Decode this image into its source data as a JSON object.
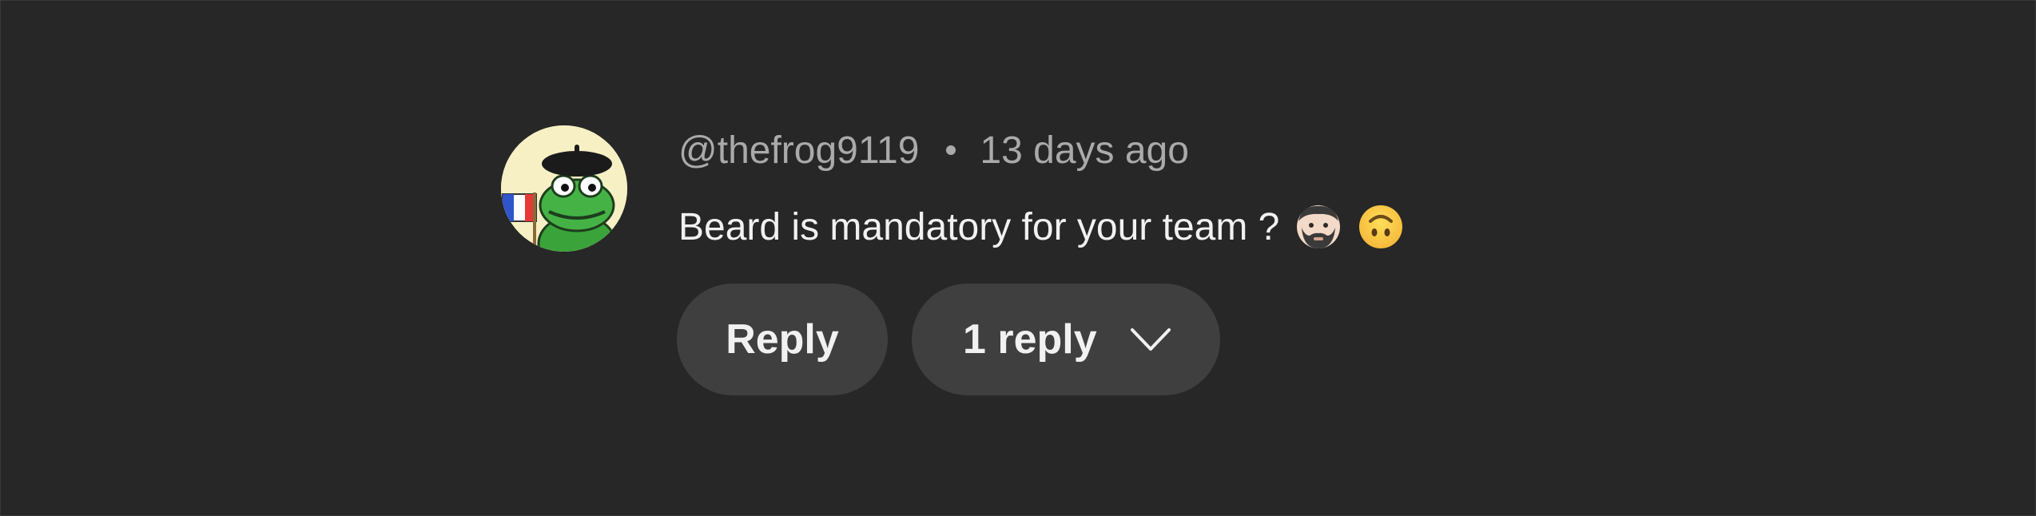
{
  "comment": {
    "author": "@thefrog9119",
    "time": "13 days ago",
    "text": "Beard is mandatory for your team ?",
    "emojis": [
      "man-beard-emoji",
      "upside-down-face-emoji"
    ]
  },
  "actions": {
    "reply_label": "Reply",
    "replies_label": "1 reply",
    "expand_icon": "chevron-down-icon"
  },
  "colors": {
    "background": "#272727",
    "button_bg": "#3f3f3f",
    "text_primary": "#f1f1f1",
    "text_secondary": "#aaaaaa"
  },
  "avatar": {
    "icon": "frog-with-beret-avatar"
  }
}
